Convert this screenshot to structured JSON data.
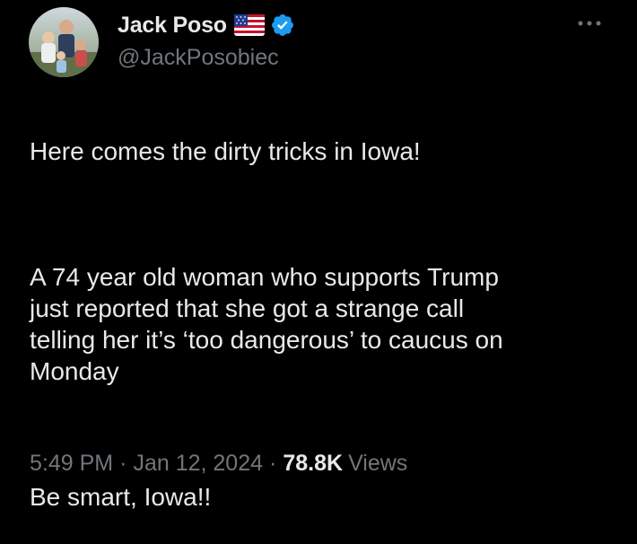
{
  "author": {
    "display_name": "Jack Poso",
    "handle": "@JackPosobiec",
    "badges": [
      "us-flag-icon",
      "verified-badge-icon"
    ],
    "avatar": "avatar-photo"
  },
  "tweet": {
    "paragraph_1": "Here comes the dirty tricks in Iowa!",
    "paragraph_2": "A 74 year old woman who supports Trump\njust reported that she got a strange call\ntelling her it’s ‘too dangerous’ to caucus on\nMonday",
    "paragraph_3": "Be smart, Iowa!!"
  },
  "meta": {
    "time": "5:49 PM",
    "separator": "·",
    "date": "Jan 12, 2024",
    "views_count": "78.8K",
    "views_label": "Views"
  },
  "colors": {
    "background": "#000000",
    "text_primary": "#e7e9ea",
    "text_secondary": "#71767b",
    "verified_blue": "#1d9bf0"
  }
}
